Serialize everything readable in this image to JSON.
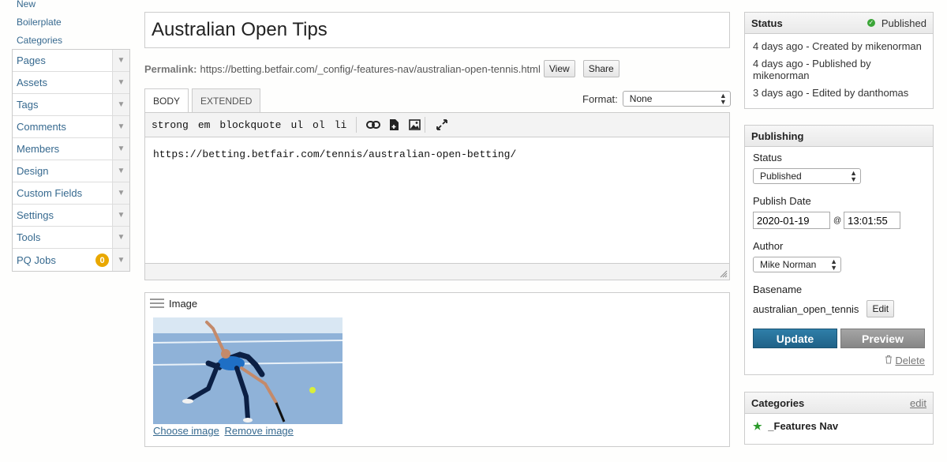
{
  "sidebar": {
    "links": [
      "New",
      "Boilerplate",
      "Categories"
    ],
    "menu": [
      {
        "label": "Pages"
      },
      {
        "label": "Assets"
      },
      {
        "label": "Tags"
      },
      {
        "label": "Comments"
      },
      {
        "label": "Members"
      },
      {
        "label": "Design"
      },
      {
        "label": "Custom Fields"
      },
      {
        "label": "Settings"
      },
      {
        "label": "Tools"
      },
      {
        "label": "PQ Jobs",
        "badge": "0"
      }
    ]
  },
  "editor": {
    "title_value": "Australian Open Tips",
    "permalink_label": "Permalink:",
    "permalink_url": "https://betting.betfair.com/_config/-features-nav/australian-open-tennis.html",
    "view_label": "View",
    "share_label": "Share",
    "tabs": [
      "BODY",
      "EXTENDED"
    ],
    "format_label": "Format:",
    "format_value": "None",
    "toolbar": [
      "strong",
      "em",
      "blockquote",
      "ul",
      "ol",
      "li"
    ],
    "body_text": "https://betting.betfair.com/tennis/australian-open-betting/",
    "image_title": "Image",
    "choose_image": "Choose image",
    "remove_image": "Remove image"
  },
  "status_widget": {
    "title": "Status",
    "state": "Published",
    "state_color": "#3aa537",
    "history": [
      "4 days ago - Created by mikenorman",
      "4 days ago - Published by mikenorman",
      "3 days ago - Edited by danthomas"
    ]
  },
  "publishing": {
    "title": "Publishing",
    "status_label": "Status",
    "status_value": "Published",
    "date_label": "Publish Date",
    "date_value": "2020-01-19",
    "at": "@",
    "time_value": "13:01:55",
    "author_label": "Author",
    "author_value": "Mike Norman",
    "basename_label": "Basename",
    "basename_value": "australian_open_tennis",
    "edit_label": "Edit",
    "update_label": "Update",
    "preview_label": "Preview",
    "delete_label": "Delete",
    "update_color": "#2a749c"
  },
  "categories": {
    "title": "Categories",
    "edit_label": "edit",
    "items": [
      "_Features Nav"
    ]
  },
  "icons": {
    "sidebar_arrow": "chevron-down-icon",
    "toolbar": [
      "link-icon",
      "insert-file-icon",
      "insert-image-icon",
      "fullscreen-icon"
    ],
    "status": "check-circle-icon",
    "delete": "trash-icon",
    "category": "star-icon"
  }
}
